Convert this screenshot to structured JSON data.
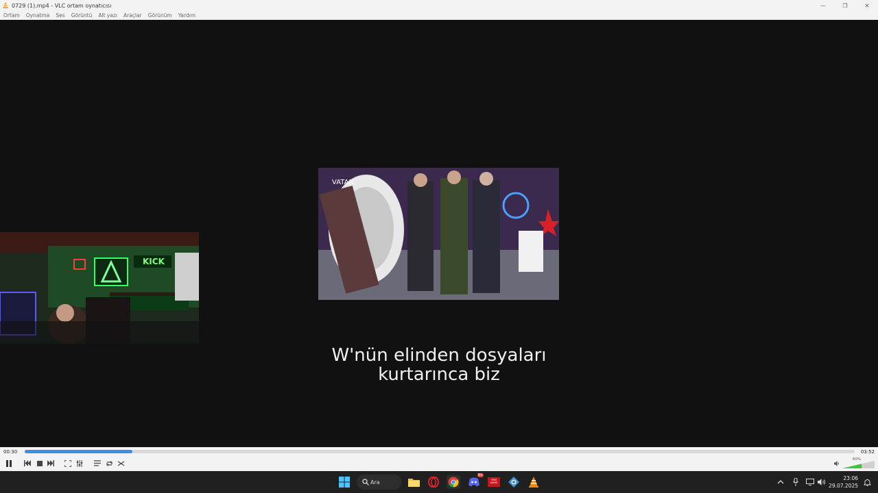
{
  "window": {
    "title": "0729 (1).mp4 - VLC ortam oynatıcısı",
    "controls": [
      "—",
      "❐",
      "✕"
    ]
  },
  "menu": [
    "Ortam",
    "Oynatma",
    "Ses",
    "Görüntü",
    "Alt yazı",
    "Araçlar",
    "Görünüm",
    "Yardım"
  ],
  "video": {
    "subtitle_line1": "W'nün elinden dosyaları",
    "subtitle_line2": "kurtarınca biz",
    "clip_sign_text": "KICK",
    "clip_label": "VATAN"
  },
  "player": {
    "elapsed": "00:30",
    "total": "03:52",
    "progress": 0.13,
    "volume_label": "60%",
    "volume": 0.6
  },
  "taskbar": {
    "search_label": "Ara",
    "clock_time": "23:06",
    "clock_date": "29.07.2025",
    "discord_badge": "9+",
    "news_tile_text": "YENİ ŞAFAK"
  },
  "colors": {
    "accent": "#3a8ee6",
    "video_bg": "#111111",
    "chrome_bg": "#f3f3f3",
    "taskbar_bg": "#202020"
  }
}
